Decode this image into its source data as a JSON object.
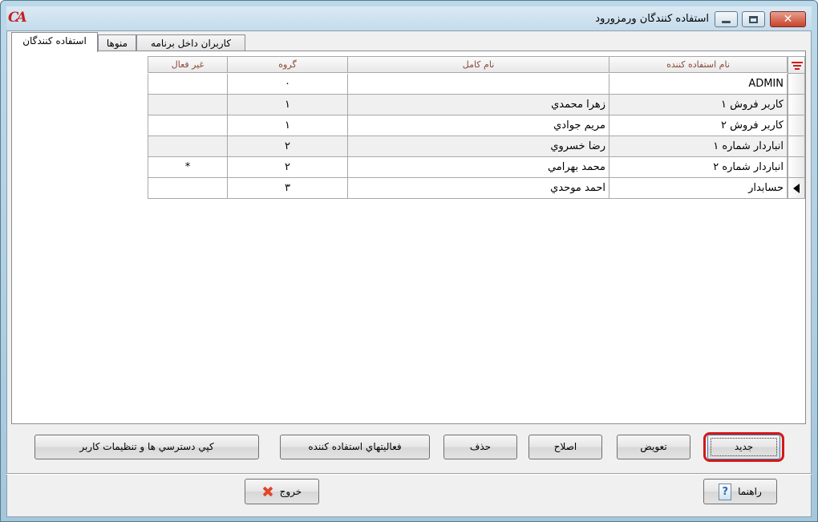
{
  "window": {
    "title": "استفاده كنندگان ورمزورود",
    "logo_text": "CA",
    "controls": {
      "minimize": "minimize-icon",
      "maximize": "maximize-icon",
      "close": "✕"
    }
  },
  "tabs": [
    {
      "label": "استفاده كنندگان",
      "active": true
    },
    {
      "label": "منوها",
      "active": false
    },
    {
      "label": "كاربران داخل برنامه",
      "active": false
    }
  ],
  "grid": {
    "columns": {
      "username": "نام استفاده كننده",
      "fullname": "نام كامل",
      "group": "گروه",
      "inactive": "غير فعال"
    },
    "rows": [
      {
        "username": "ADMIN",
        "fullname": "",
        "group": "٠",
        "inactive": ""
      },
      {
        "username": "كاربر فروش ١",
        "fullname": "زهرا محمدي",
        "group": "١",
        "inactive": ""
      },
      {
        "username": "كاربر فروش ٢",
        "fullname": "مريم جوادي",
        "group": "١",
        "inactive": ""
      },
      {
        "username": "انباردار شماره ١",
        "fullname": "رضا خسروي",
        "group": "٢",
        "inactive": ""
      },
      {
        "username": "انباردار شماره ٢",
        "fullname": "محمد بهرامي",
        "group": "٢",
        "inactive": "*"
      },
      {
        "username": "حسابدار",
        "fullname": "احمد موحدي",
        "group": "٣",
        "inactive": ""
      }
    ],
    "current_row_index": 5
  },
  "actions": {
    "new": "جديد",
    "replace": "تعويض",
    "edit": "اصلاح",
    "delete": "حذف",
    "activities": "فعاليتهاي استفاده كننده",
    "copy_access": "كپي دسترسي ها و تنظيمات كاربر"
  },
  "footer": {
    "help": "راهنما",
    "exit": "خروج"
  },
  "colors": {
    "highlight": "#d41818",
    "header_text": "#8b4a3a",
    "close_button": "#c7432a"
  }
}
